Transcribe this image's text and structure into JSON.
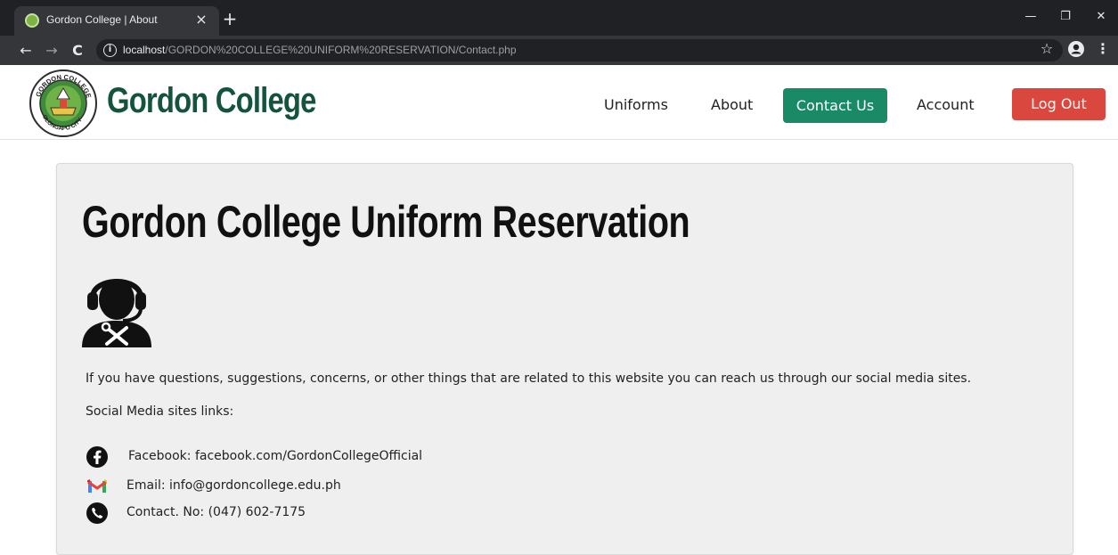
{
  "browser": {
    "tab_title": "Gordon College | About",
    "tab_close": "×",
    "new_tab": "+",
    "url_host": "localhost",
    "url_path": "/GORDON%20COLLEGE%20UNIFORM%20RESERVATION/Contact.php",
    "back": "←",
    "forward": "→",
    "reload": "C",
    "star": "☆",
    "menu": "⋮",
    "minimize": "—",
    "maximize": "❐",
    "close": "✕"
  },
  "header": {
    "logo_text_top": "GORDON COLLEGE",
    "logo_text_bottom": "OLONGAPO CITY",
    "brand": "Gordon College",
    "nav": {
      "uniforms": "Uniforms",
      "about": "About",
      "contact": "Contact Us",
      "account": "Account"
    },
    "logout": "Log Out"
  },
  "main": {
    "title": "Gordon College Uniform Reservation",
    "intro": "If you have questions, suggestions, concerns, or other things that are related to this website you can reach us through our social media sites.",
    "social_label": "Social Media sites links:",
    "contacts": {
      "facebook": "Facebook: facebook.com/GordonCollegeOfficial",
      "email": "Email: info@gordoncollege.edu.ph",
      "phone": "Contact. No: (047) 602-7175"
    }
  },
  "colors": {
    "brand_green": "#14533c",
    "contact_button": "#1a8a66",
    "logout_button": "#d9473f",
    "card_bg": "#efefef"
  },
  "icons": {
    "support": "customer-support-icon",
    "facebook": "facebook-icon",
    "gmail": "gmail-icon",
    "phone": "phone-icon"
  }
}
